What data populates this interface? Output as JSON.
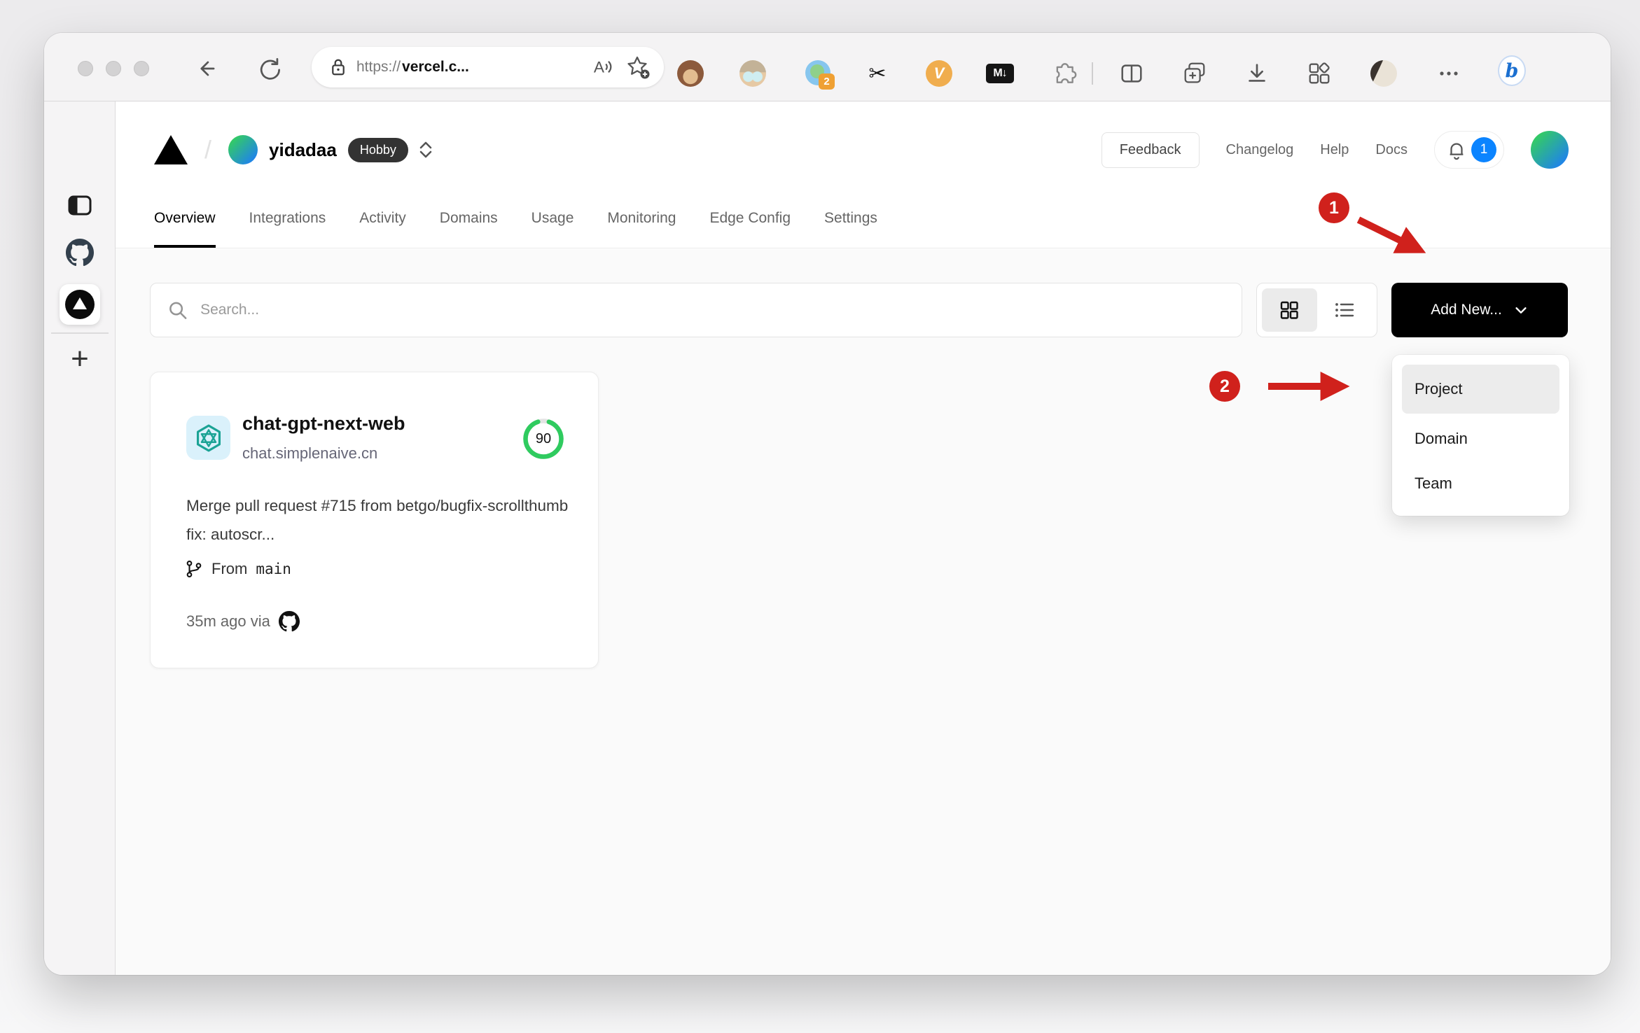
{
  "browser": {
    "url": {
      "scheme": "https://",
      "host": "vercel.c..."
    },
    "extension_badge_count": "2",
    "v_extension_label": "V",
    "markdown_extension_label": "M↓",
    "bing_label": "b",
    "new_tab_label": "+"
  },
  "header": {
    "team_name": "yidadaa",
    "plan_badge": "Hobby",
    "feedback_label": "Feedback",
    "links": {
      "changelog": "Changelog",
      "help": "Help",
      "docs": "Docs"
    },
    "notification_count": "1",
    "nav": [
      {
        "label": "Overview"
      },
      {
        "label": "Integrations"
      },
      {
        "label": "Activity"
      },
      {
        "label": "Domains"
      },
      {
        "label": "Usage"
      },
      {
        "label": "Monitoring"
      },
      {
        "label": "Edge Config"
      },
      {
        "label": "Settings"
      }
    ]
  },
  "controls": {
    "search_placeholder": "Search...",
    "add_new_label": "Add New..."
  },
  "dropdown": {
    "items": [
      {
        "label": "Project"
      },
      {
        "label": "Domain"
      },
      {
        "label": "Team"
      }
    ]
  },
  "project_card": {
    "name": "chat-gpt-next-web",
    "domain": "chat.simplenaive.cn",
    "score": "90",
    "commit_message": "Merge pull request #715 from betgo/bugfix-scrollthumb fix: autoscr...",
    "branch_prefix": "From",
    "branch_name": "main",
    "deployed_meta": "35m ago via"
  },
  "annotations": [
    {
      "label": "1"
    },
    {
      "label": "2"
    }
  ],
  "colors": {
    "annotation_red": "#d0211c",
    "ring_green": "#2fcb5f",
    "notification_blue": "#0b84ff",
    "add_button_black": "#000000"
  }
}
